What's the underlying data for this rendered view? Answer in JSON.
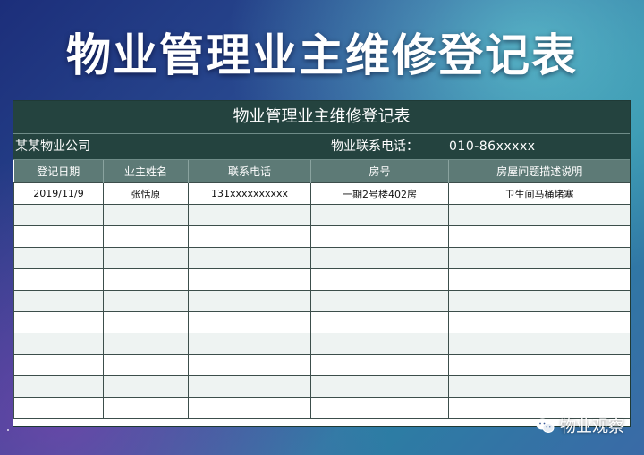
{
  "banner": {
    "title": "物业管理业主维修登记表"
  },
  "sheet": {
    "title": "物业管理业主维修登记表",
    "company": "某某物业公司",
    "phone_label": "物业联系电话：",
    "phone_value": "010-86xxxxx",
    "columns": [
      "登记日期",
      "业主姓名",
      "联系电话",
      "房号",
      "房屋问题描述说明"
    ],
    "rows": [
      [
        "2019/11/9",
        "张恬原",
        "131xxxxxxxxxx",
        "一期2号楼402房",
        "卫生间马桶堵塞"
      ],
      [
        "",
        "",
        "",
        "",
        ""
      ],
      [
        "",
        "",
        "",
        "",
        ""
      ],
      [
        "",
        "",
        "",
        "",
        ""
      ],
      [
        "",
        "",
        "",
        "",
        ""
      ],
      [
        "",
        "",
        "",
        "",
        ""
      ],
      [
        "",
        "",
        "",
        "",
        ""
      ],
      [
        "",
        "",
        "",
        "",
        ""
      ],
      [
        "",
        "",
        "",
        "",
        ""
      ],
      [
        "",
        "",
        "",
        "",
        ""
      ],
      [
        "",
        "",
        "",
        "",
        ""
      ]
    ]
  },
  "watermark": {
    "icon": "wechat-icon",
    "text": "物业观察"
  }
}
